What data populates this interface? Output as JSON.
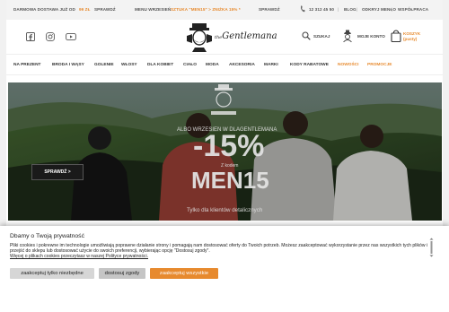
{
  "topbar": {
    "shipping_text": "DARMOWA DOSTAWA JUŻ OD",
    "shipping_amount": "99 ZŁ",
    "check_link": "SPRAWDŹ",
    "promo_prefix": "MENU WRZESIEŃ",
    "promo_highlight": "SZTUKA \"MEN15\" > ZNIŻKA 15% *",
    "promo_link": "SPRAWDŹ",
    "phone": "12 312 45 50",
    "links": [
      "BLOG",
      "ODKRYJ MENŁO",
      "WSPÓŁPRACA"
    ]
  },
  "header": {
    "logo_prefix": "the",
    "logo_name": "Gentlemana",
    "search_label": "SZUKAJ",
    "account_label": "MOJE KONTO",
    "cart_label": "KOSZYK",
    "cart_status": "(pusty)",
    "social_icons": [
      "facebook-icon",
      "instagram-icon",
      "youtube-icon"
    ]
  },
  "nav": {
    "items": [
      "NA PREZENT",
      "BRODA I WĄSY",
      "GOLENIE",
      "WŁOSY",
      "DLA KOBIET",
      "CIAŁO",
      "MODA",
      "AKCESORIA",
      "MARKI",
      "KODY RABATOWE",
      "NOWOŚCI",
      "PROMOCJE"
    ],
    "highlighted": [
      "NOWOŚCI",
      "PROMOCJE"
    ]
  },
  "hero": {
    "subtitle": "ALBO WRZESIEŃ W DLAGENTLEMANA",
    "discount": "-15%",
    "code_label": "Z kodem",
    "code": "MEN15",
    "note": "Tylko dla klientów detalicznych",
    "button": "SPRAWDŹ >"
  },
  "cookie": {
    "title": "Dbamy o Twoją prywatność",
    "body": "Pliki cookies i pokrewne im technologie umożliwiają poprawne działanie strony i pomagają nam dostosować oferty do Twoich potrzeb. Możesz zaakceptować wykorzystanie przez nas wszystkich tych plików i przejść do sklepu lub dostosować użycie do swoich preferencji, wybierając opcję \"Dostosuj zgody\".",
    "link_text": "Więcej o plikach cookies przeczytasz w naszej Polityce prywatności.",
    "buttons": {
      "necessary": "zaakceptuj tylko niezbędne",
      "customize": "dostosuj zgody",
      "accept_all": "zaakceptuj wszystkie"
    }
  },
  "colors": {
    "accent": "#e78a2e",
    "dark": "#1a1a1a",
    "topbar_bg": "#f3f3f3"
  }
}
